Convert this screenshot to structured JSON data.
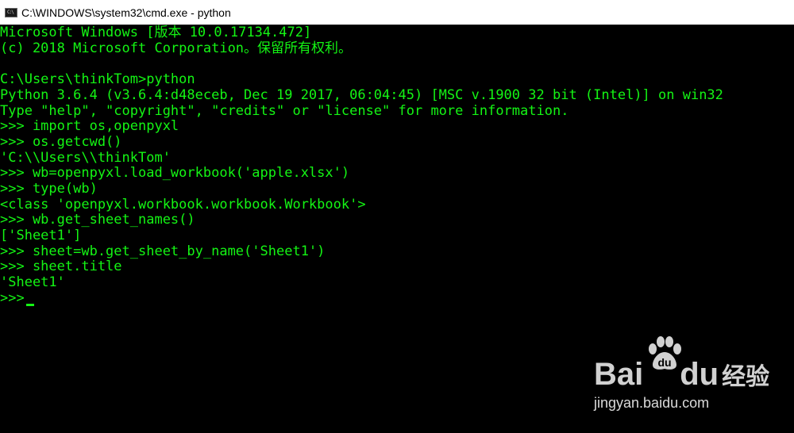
{
  "window": {
    "title": "C:\\WINDOWS\\system32\\cmd.exe - python",
    "icon": "cmd-console-icon",
    "icon_mark": "C:\\"
  },
  "console": {
    "text_color": "#14f514",
    "background": "#000000",
    "lines": [
      "Microsoft Windows [版本 10.0.17134.472]",
      "(c) 2018 Microsoft Corporation。保留所有权利。",
      "",
      "C:\\Users\\thinkTom>python",
      "Python 3.6.4 (v3.6.4:d48eceb, Dec 19 2017, 06:04:45) [MSC v.1900 32 bit (Intel)] on win32",
      "Type \"help\", \"copyright\", \"credits\" or \"license\" for more information.",
      ">>> import os,openpyxl",
      ">>> os.getcwd()",
      "'C:\\\\Users\\\\thinkTom'",
      ">>> wb=openpyxl.load_workbook('apple.xlsx')",
      ">>> type(wb)",
      "<class 'openpyxl.workbook.workbook.Workbook'>",
      ">>> wb.get_sheet_names()",
      "['Sheet1']",
      ">>> sheet=wb.get_sheet_by_name('Sheet1')",
      ">>> sheet.title",
      "'Sheet1'",
      ">>>"
    ]
  },
  "watermark": {
    "brand_left": "Bai",
    "brand_right": "du",
    "brand_cn": "经验",
    "url": "jingyan.baidu.com",
    "icon": "baidu-paw-icon"
  }
}
